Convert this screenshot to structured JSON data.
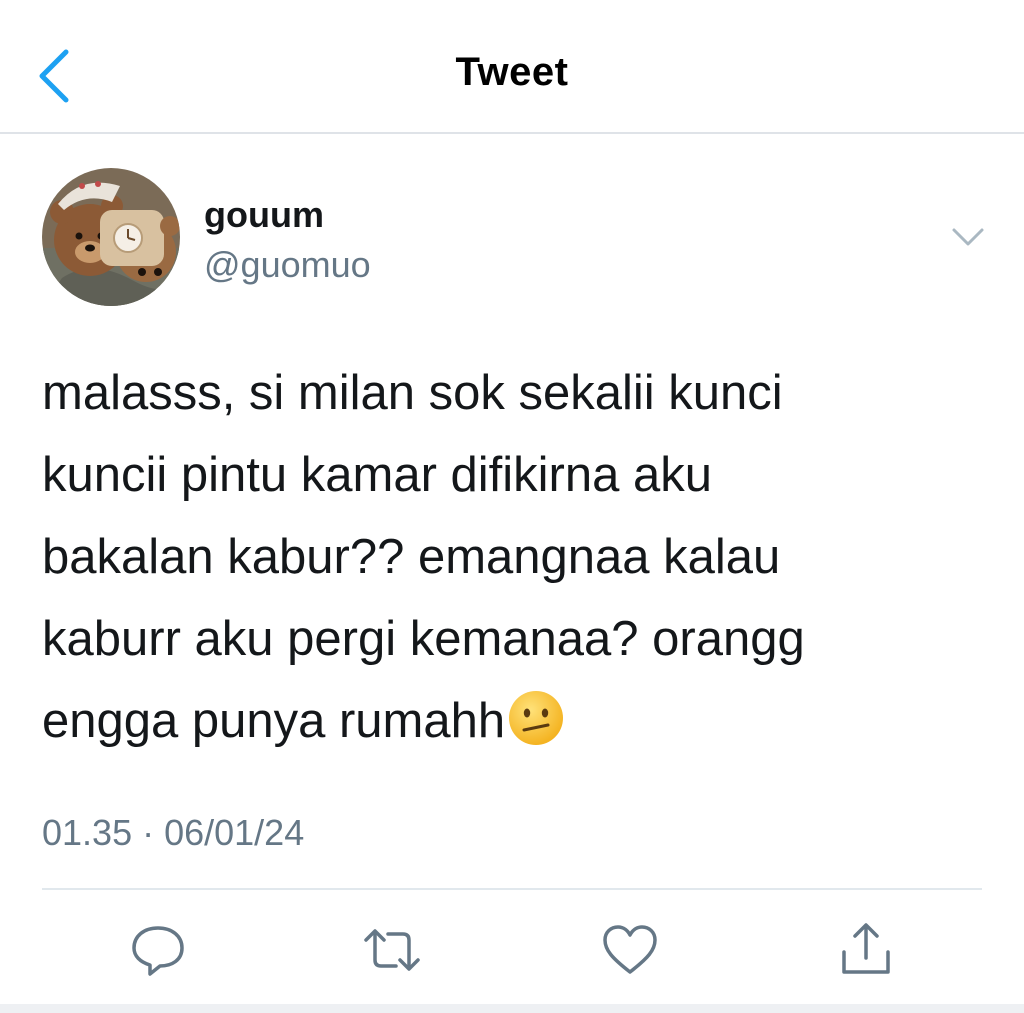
{
  "header": {
    "title": "Tweet",
    "back_icon": "chevron-left-icon"
  },
  "author": {
    "display_name": "gouum",
    "handle": "@guomuo"
  },
  "tweet": {
    "lines": [
      "malasss, si milan sok sekalii kunci",
      "kuncii pintu kamar difikirna aku",
      "bakalan kabur?? emangnaa kalau",
      "kaburr aku pergi kemanaa? orangg",
      "engga punya rumahh"
    ],
    "emoji": "confused-face-emoji",
    "timestamp": "01.35 · 06/01/24"
  },
  "actions": {
    "icons": [
      "reply-icon",
      "retweet-icon",
      "like-icon",
      "share-icon"
    ]
  },
  "colors": {
    "accent": "#1da1f2",
    "secondary_text": "#657786",
    "icon": "#657786",
    "divider": "#e1e8ed"
  }
}
